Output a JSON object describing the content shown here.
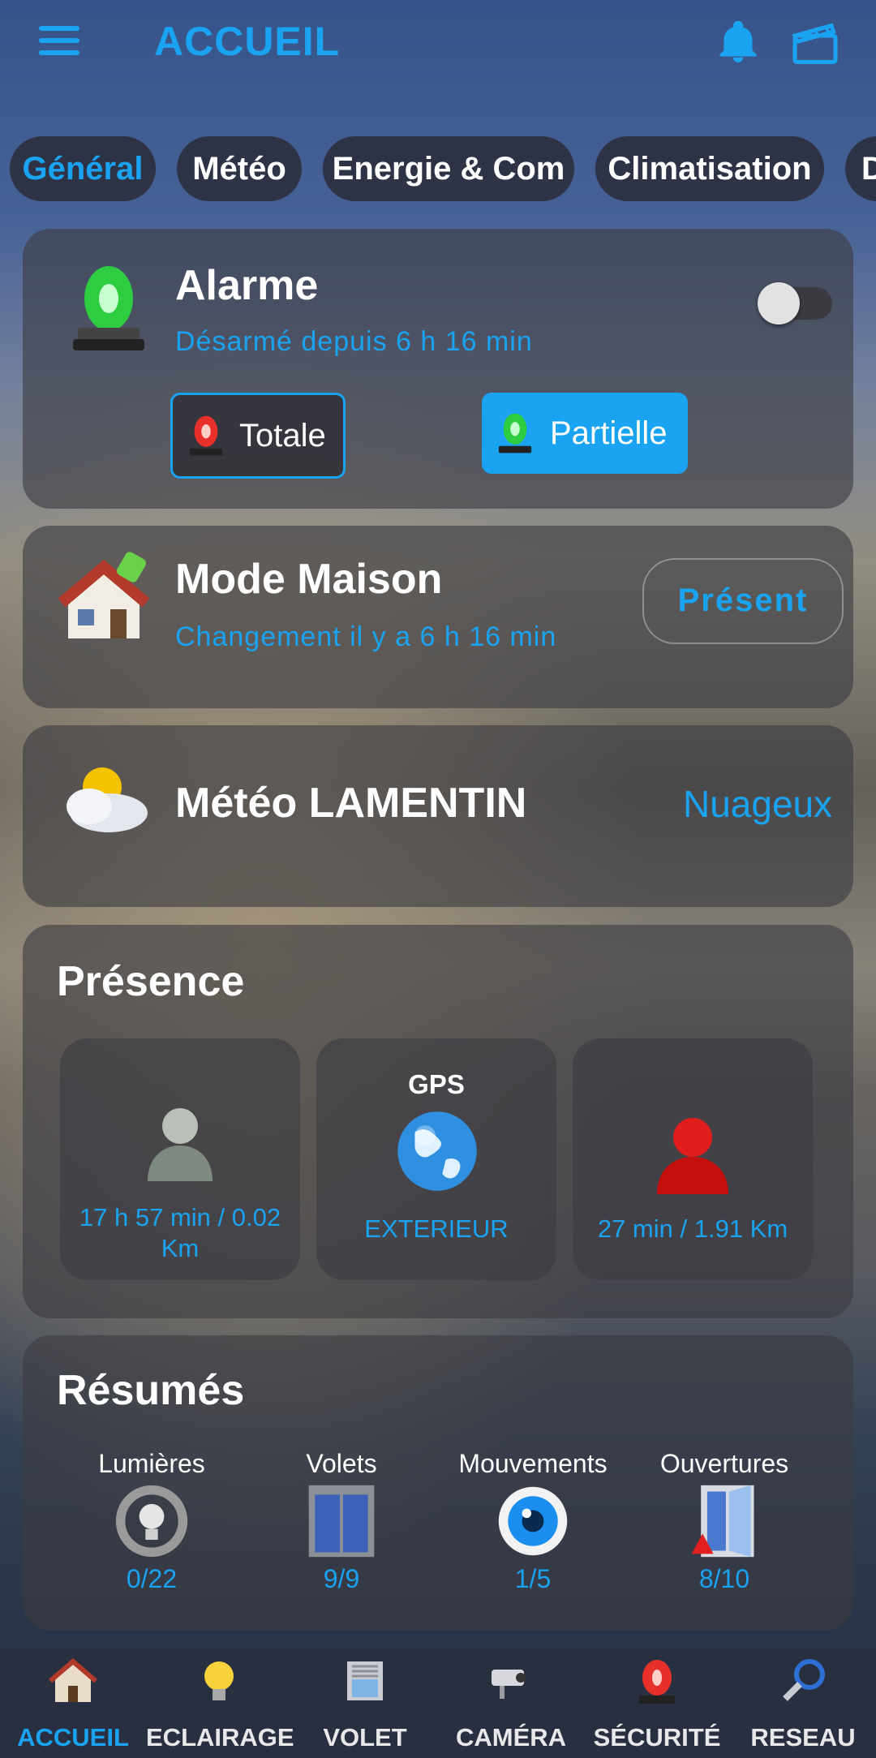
{
  "header": {
    "title": "ACCUEIL"
  },
  "tabs": [
    {
      "label": "Général"
    },
    {
      "label": "Météo"
    },
    {
      "label": "Energie & Com"
    },
    {
      "label": "Climatisation"
    },
    {
      "label": "D"
    }
  ],
  "alarm": {
    "title": "Alarme",
    "status": "Désarmé depuis 6 h 16 min",
    "toggle_on": false,
    "btn_total": "Totale",
    "btn_partial": "Partielle"
  },
  "mode": {
    "title": "Mode Maison",
    "status": "Changement il y a 6 h 16 min",
    "value": "Présent"
  },
  "weather": {
    "title": "Météo LAMENTIN",
    "value": "Nuageux"
  },
  "presence": {
    "title": "Présence",
    "cards": [
      {
        "label": "",
        "text": "17 h 57 min / 0.02 Km"
      },
      {
        "label": "GPS",
        "text": "EXTERIEUR"
      },
      {
        "label": "",
        "text": "27 min / 1.91 Km"
      }
    ]
  },
  "summary": {
    "title": "Résumés",
    "items": [
      {
        "label": "Lumières",
        "value": "0/22"
      },
      {
        "label": "Volets",
        "value": "9/9"
      },
      {
        "label": "Mouvements",
        "value": "1/5"
      },
      {
        "label": "Ouvertures",
        "value": "8/10"
      }
    ]
  },
  "nav": [
    {
      "label": "ACCUEIL",
      "icon": "house-icon"
    },
    {
      "label": "ECLAIRAGE",
      "icon": "bulb-icon"
    },
    {
      "label": "VOLET",
      "icon": "shutter-icon"
    },
    {
      "label": "CAMÉRA",
      "icon": "camera-icon"
    },
    {
      "label": "SÉCURITÉ",
      "icon": "siren-icon"
    },
    {
      "label": "RESEAU",
      "icon": "network-icon"
    }
  ],
  "colors": {
    "accent": "#1aa3f0"
  }
}
